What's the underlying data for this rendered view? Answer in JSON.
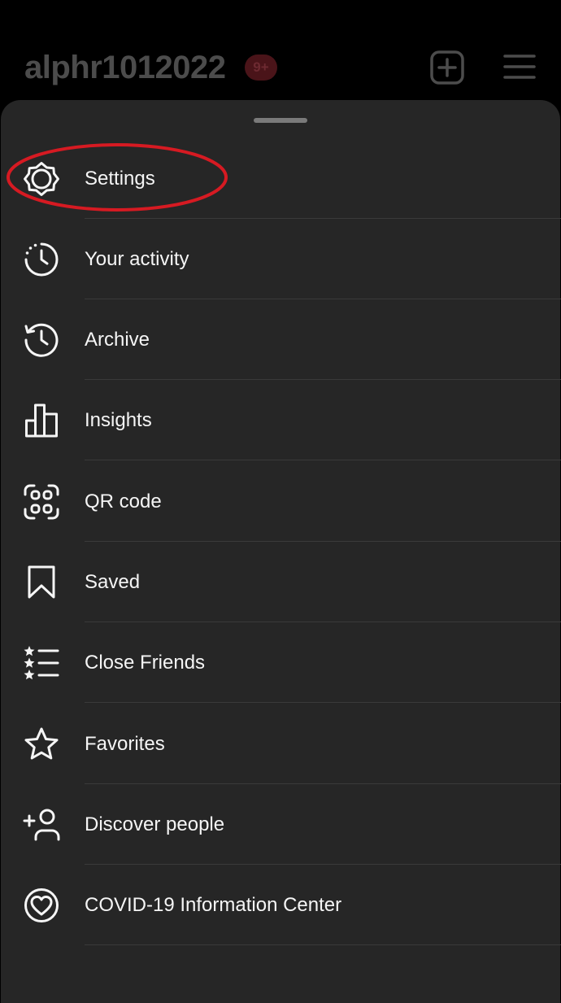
{
  "header": {
    "username": "alphr1012022",
    "notification_badge": "9+",
    "new_post_icon": "plus-square-icon",
    "menu_icon": "hamburger-menu-icon"
  },
  "colors": {
    "background": "#000000",
    "sheet": "#262626",
    "text": "#f5f5f5",
    "highlight": "#d61a22"
  },
  "menu": {
    "items": [
      {
        "label": "Settings",
        "icon": "settings-gear-icon"
      },
      {
        "label": "Your activity",
        "icon": "activity-clock-icon"
      },
      {
        "label": "Archive",
        "icon": "archive-history-icon"
      },
      {
        "label": "Insights",
        "icon": "insights-bar-chart-icon"
      },
      {
        "label": "QR code",
        "icon": "qr-code-icon"
      },
      {
        "label": "Saved",
        "icon": "bookmark-icon"
      },
      {
        "label": "Close Friends",
        "icon": "close-friends-list-icon"
      },
      {
        "label": "Favorites",
        "icon": "star-icon"
      },
      {
        "label": "Discover people",
        "icon": "add-person-icon"
      },
      {
        "label": "COVID-19 Information Center",
        "icon": "covid-heart-icon"
      }
    ]
  }
}
